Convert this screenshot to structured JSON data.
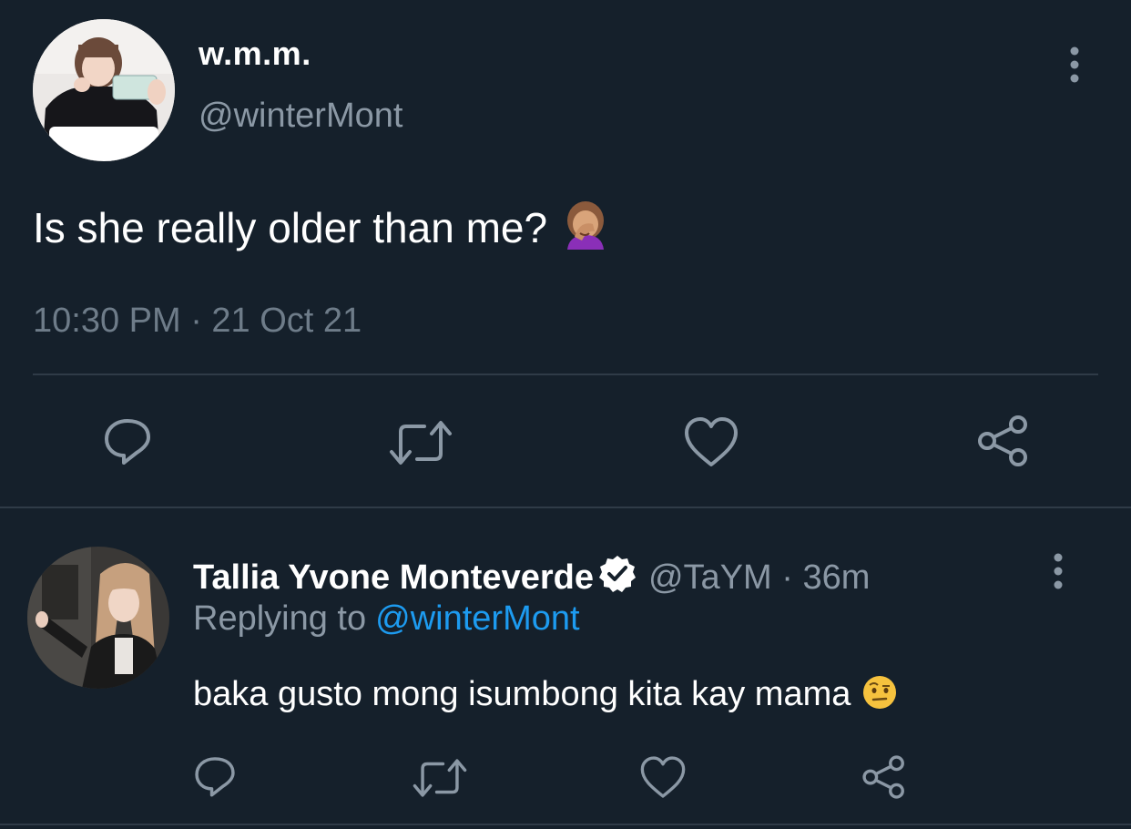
{
  "tweet": {
    "author_name": "w.m.m.",
    "author_handle": "@winterMont",
    "text": "Is she really older than me?",
    "emoji": "woman-facepalming-emoji",
    "timestamp": "10:30 PM · 21 Oct 21",
    "actions": [
      "reply-icon",
      "retweet-icon",
      "like-icon",
      "share-icon"
    ]
  },
  "reply": {
    "author_name": "Tallia Yvone Monteverde",
    "verified": true,
    "author_handle": "@TaYM",
    "separator": "·",
    "time": "36m",
    "replying_label": "Replying to",
    "replying_handle": "@winterMont",
    "text": "baka gusto mong isumbong kita kay mama",
    "emoji": "face-with-raised-eyebrow-emoji",
    "actions": [
      "reply-icon",
      "retweet-icon",
      "like-icon",
      "share-icon"
    ]
  },
  "colors": {
    "background": "#15202b",
    "primary_text": "#ffffff",
    "secondary_text": "#8b98a5",
    "link": "#1d9bf0",
    "divider": "#2f3b47"
  }
}
